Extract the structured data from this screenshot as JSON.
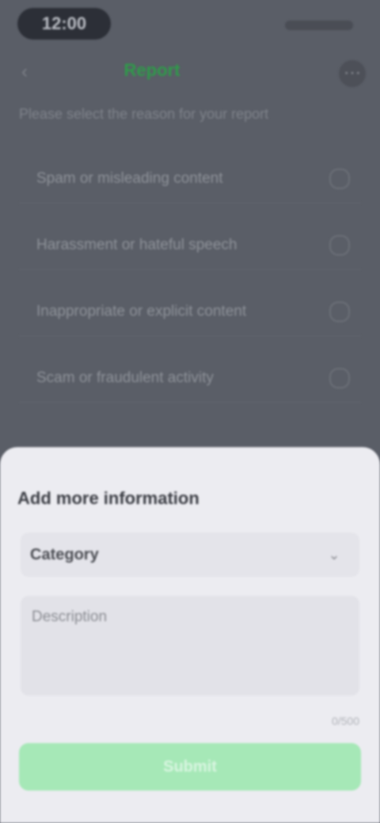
{
  "status_bar": {
    "time": "12:00"
  },
  "nav": {
    "back_icon": "back-arrow-icon",
    "title": "Report",
    "more_icon": "more-icon"
  },
  "page": {
    "subtitle": "Please select the reason for your report",
    "options": [
      {
        "label": "Spam or misleading content"
      },
      {
        "label": "Harassment or hateful speech"
      },
      {
        "label": "Inappropriate or explicit content"
      },
      {
        "label": "Scam or fraudulent activity"
      }
    ]
  },
  "sheet": {
    "title": "Add more information",
    "select_value": "Category",
    "textarea_placeholder": "Description",
    "char_count": "0/500",
    "submit_label": "Submit"
  },
  "colors": {
    "accent": "#2f9a4a",
    "submit_bg": "#a6e8b7",
    "sheet_bg": "#ececf1",
    "overlay_bg": "#5a5e67"
  }
}
